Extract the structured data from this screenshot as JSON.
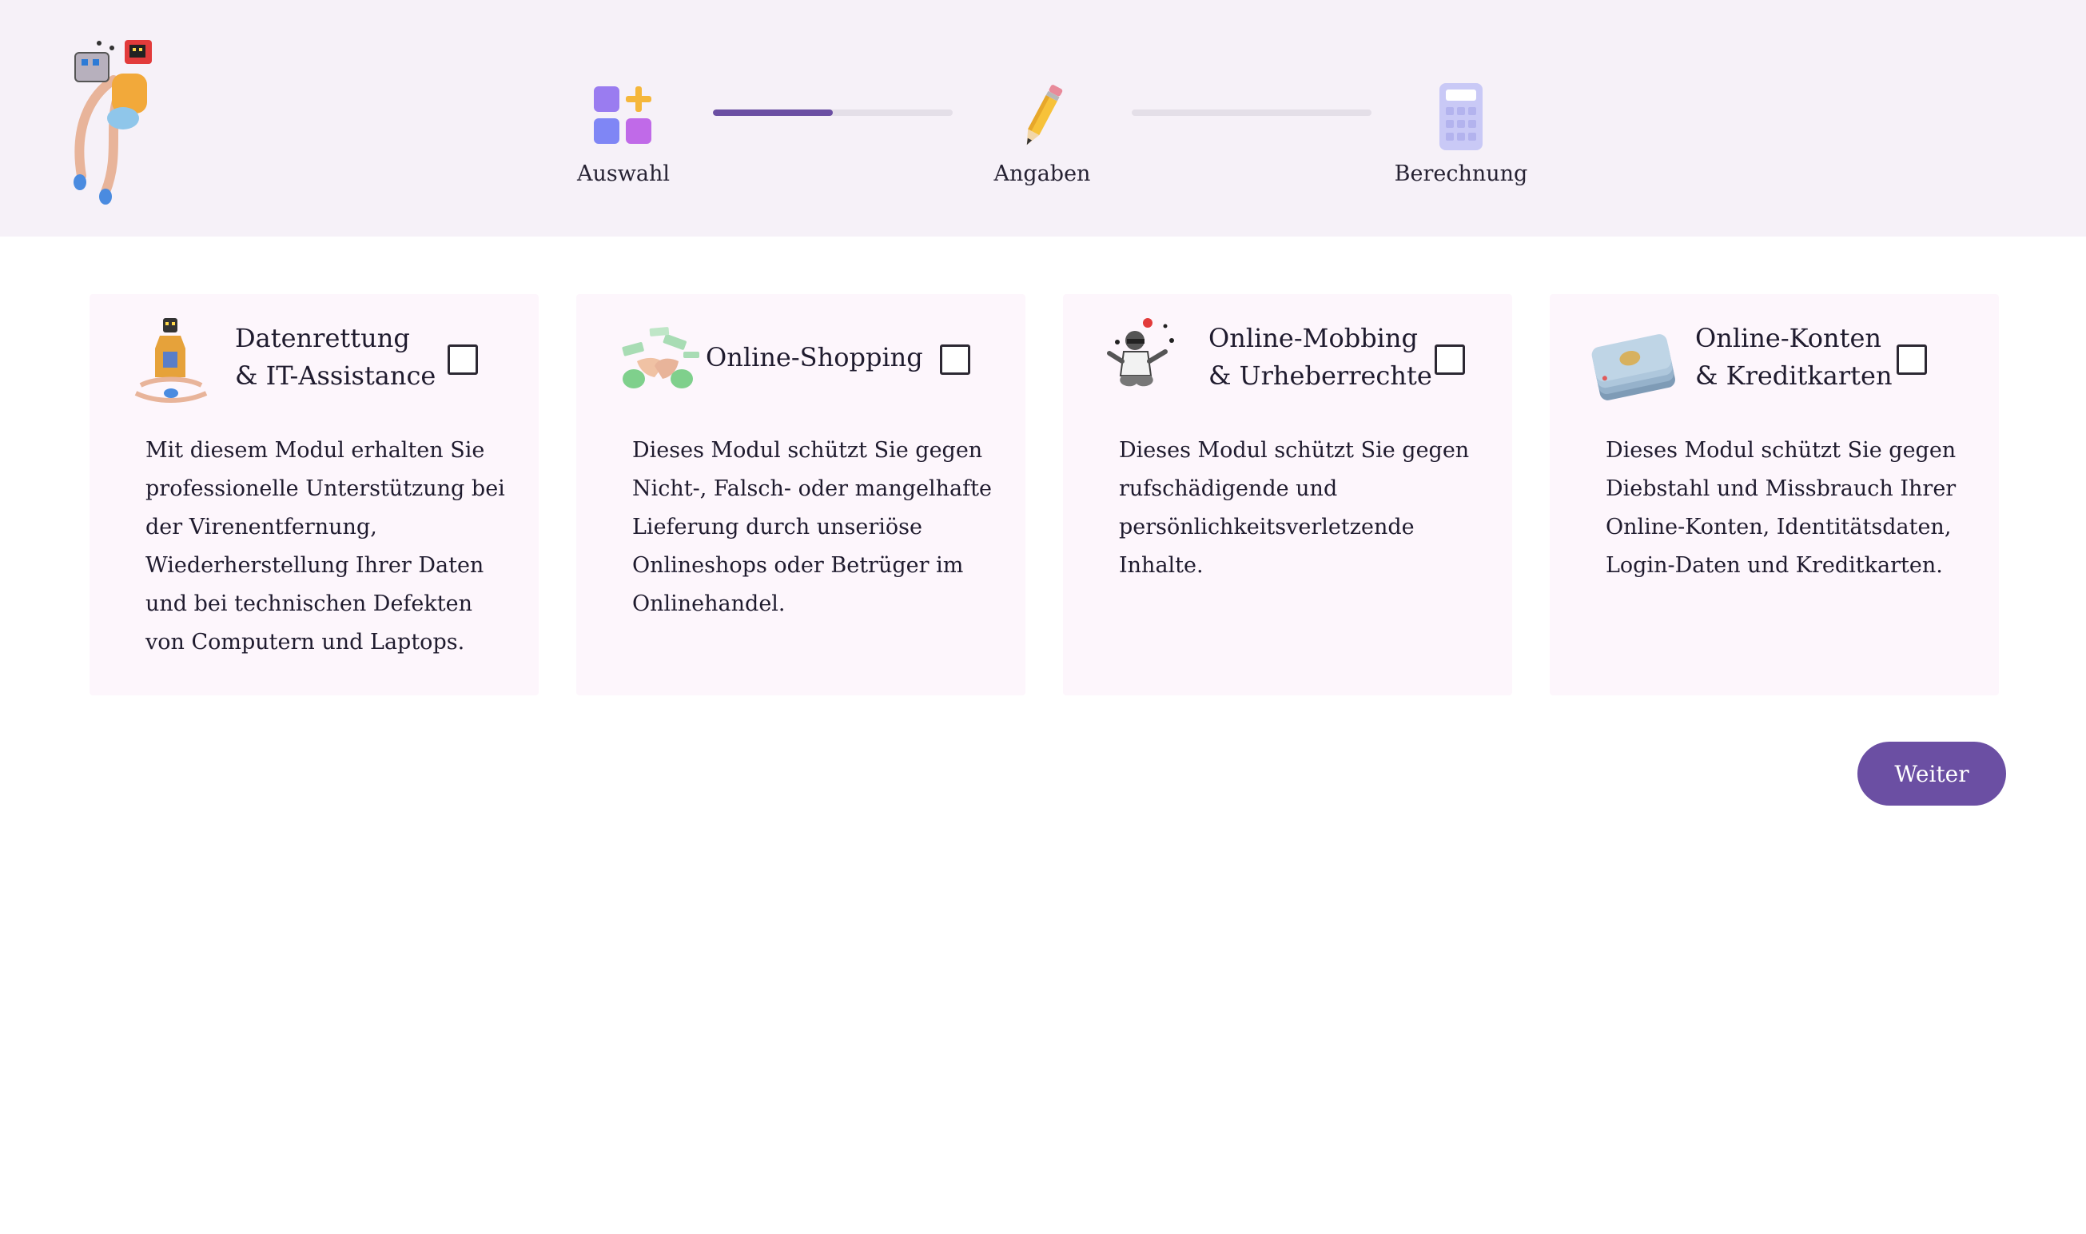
{
  "header": {
    "logo_icon": "robot-character-logo",
    "steps": [
      {
        "label": "Auswahl",
        "icon": "grid-plus-icon"
      },
      {
        "label": "Angaben",
        "icon": "pencil-icon"
      },
      {
        "label": "Berechnung",
        "icon": "calculator-icon"
      }
    ],
    "progress": [
      0.5,
      0.0
    ],
    "accent_color": "#6b4fa3",
    "background_color": "#f6f1f8"
  },
  "modules": [
    {
      "title_line1": "Datenrettung",
      "title_line2": "& IT-Assistance",
      "description": "Mit diesem Modul erhalten Sie professionelle Unterstützung bei der Virenentfernung, Wiederherstellung Ihrer Daten und bei technischen Defekten von Computern und Laptops.",
      "icon": "robot-bottle-icon",
      "checked": false
    },
    {
      "title_line1": "Online-Shopping",
      "title_line2": "",
      "description": "Dieses Modul schützt Sie gegen Nicht-, Falsch- oder mangelhafte Lieferung durch unseriöse Onlineshops oder Betrüger im Onlinehandel.",
      "icon": "money-hands-icon",
      "checked": false
    },
    {
      "title_line1": "Online-Mobbing",
      "title_line2": "& Urheberrechte",
      "description": "Dieses Modul schützt Sie gegen rufschädigende und persönlichkeitsverletzende Inhalte.",
      "icon": "juggler-figure-icon",
      "checked": false
    },
    {
      "title_line1": "Online-Konten",
      "title_line2": "& Kreditkarten",
      "description": "Dieses Modul schützt Sie gegen Diebstahl und Missbrauch Ihrer Online-Konten, Identitätsdaten, Login-Daten und Kreditkarten.",
      "icon": "credit-card-stack-icon",
      "checked": false
    }
  ],
  "actions": {
    "next_label": "Weiter"
  }
}
